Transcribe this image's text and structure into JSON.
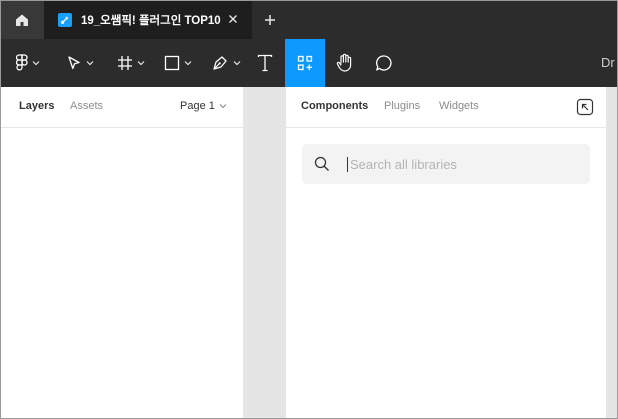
{
  "tabbar": {
    "home_icon": "home-icon",
    "file_icon": "figma-file-icon",
    "tab_title": "19_오쌤픽! 플러그인 TOP10",
    "close_icon": "close-icon",
    "new_tab_icon": "plus-icon"
  },
  "toolbar": {
    "tools": [
      {
        "name": "main-menu",
        "icon": "figma-logo-icon",
        "has_dropdown": true
      },
      {
        "name": "move-tool",
        "icon": "cursor-arrow-icon",
        "has_dropdown": true
      },
      {
        "name": "frame-tool",
        "icon": "frame-hash-icon",
        "has_dropdown": true
      },
      {
        "name": "shape-tool",
        "icon": "rectangle-icon",
        "has_dropdown": true
      },
      {
        "name": "pen-tool",
        "icon": "pen-icon",
        "has_dropdown": true
      },
      {
        "name": "text-tool",
        "icon": "text-T-icon",
        "has_dropdown": false
      },
      {
        "name": "resources-tool",
        "icon": "resources-grid-icon",
        "active": true
      },
      {
        "name": "hand-tool",
        "icon": "hand-icon",
        "has_dropdown": false
      },
      {
        "name": "comment-tool",
        "icon": "comment-bubble-icon",
        "has_dropdown": false
      }
    ],
    "doc_label": "Dr",
    "accent_color": "#0d99ff"
  },
  "left_panel": {
    "tabs": [
      "Layers",
      "Assets"
    ],
    "active_tab": "Layers",
    "page_label": "Page 1"
  },
  "resources_panel": {
    "tabs": [
      "Components",
      "Plugins",
      "Widgets"
    ],
    "active_tab": "Components",
    "collapse_icon": "collapse-arrow-icon",
    "search": {
      "placeholder": "Search all libraries",
      "value": ""
    }
  }
}
